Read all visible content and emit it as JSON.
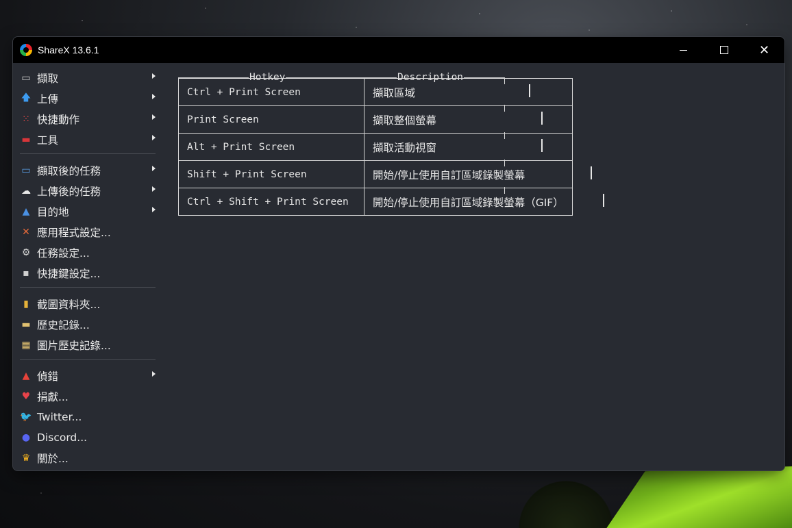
{
  "app": {
    "title": "ShareX 13.6.1"
  },
  "menu": {
    "items": [
      {
        "label": "擷取",
        "icon": "capture-icon",
        "glyph": "▭",
        "color": "#cfcfcf",
        "submenu": true
      },
      {
        "label": "上傳",
        "icon": "upload-arrow-icon",
        "glyph": "🡅",
        "color": "#3d9bf0",
        "submenu": true
      },
      {
        "label": "快捷動作",
        "icon": "quick-actions-grid-icon",
        "glyph": "⁙",
        "color": "#e84a4a",
        "submenu": true
      },
      {
        "label": "工具",
        "icon": "toolbox-icon",
        "glyph": "▬",
        "color": "#d8363a",
        "submenu": true
      },
      {
        "label": "擷取後的任務",
        "icon": "after-capture-icon",
        "glyph": "▭",
        "color": "#5aa0e8",
        "submenu": true
      },
      {
        "label": "上傳後的任務",
        "icon": "cloud-upload-icon",
        "glyph": "☁",
        "color": "#e6e6e6",
        "submenu": true
      },
      {
        "label": "目的地",
        "icon": "destinations-icon",
        "glyph": "▲",
        "color": "#4a90e2",
        "submenu": true
      },
      {
        "label": "應用程式設定...",
        "icon": "app-settings-tools-icon",
        "glyph": "✕",
        "color": "#e66a3a",
        "submenu": false
      },
      {
        "label": "任務設定...",
        "icon": "gear-icon",
        "glyph": "⚙",
        "color": "#d0d0d0",
        "submenu": false
      },
      {
        "label": "快捷鍵設定...",
        "icon": "keyboard-icon",
        "glyph": "▪",
        "color": "#d0d0d0",
        "submenu": false
      },
      {
        "label": "截圖資料夾...",
        "icon": "folder-icon",
        "glyph": "▮",
        "color": "#e6b23a",
        "submenu": false
      },
      {
        "label": "歷史記錄...",
        "icon": "history-icon",
        "glyph": "▬",
        "color": "#e0c070",
        "submenu": false
      },
      {
        "label": "圖片歷史記錄...",
        "icon": "image-history-icon",
        "glyph": "▦",
        "color": "#e0c070",
        "submenu": false
      },
      {
        "label": "偵錯",
        "icon": "debug-cone-icon",
        "glyph": "▲",
        "color": "#e8433a",
        "submenu": true
      },
      {
        "label": "捐獻...",
        "icon": "heart-icon",
        "glyph": "♥",
        "color": "#e8434a",
        "submenu": false
      },
      {
        "label": "Twitter...",
        "icon": "twitter-bird-icon",
        "glyph": "🐦",
        "color": "#1da1f2",
        "submenu": false
      },
      {
        "label": "Discord...",
        "icon": "discord-icon",
        "glyph": "●",
        "color": "#5865f2",
        "submenu": false
      },
      {
        "label": "關於...",
        "icon": "crown-icon",
        "glyph": "♛",
        "color": "#f0b020",
        "submenu": false
      }
    ]
  },
  "hotkeys": {
    "headers": {
      "hotkey": "Hotkey",
      "description": "Description"
    },
    "rows": [
      {
        "hotkey": "Ctrl + Print Screen",
        "description": "擷取區域"
      },
      {
        "hotkey": "Print Screen",
        "description": "擷取整個螢幕"
      },
      {
        "hotkey": "Alt + Print Screen",
        "description": "擷取活動視窗"
      },
      {
        "hotkey": "Shift + Print Screen",
        "description": "開始/停止使用自訂區域錄製螢幕"
      },
      {
        "hotkey": "Ctrl + Shift + Print Screen",
        "description": "開始/停止使用自訂區域錄製螢幕（GIF）"
      }
    ]
  }
}
